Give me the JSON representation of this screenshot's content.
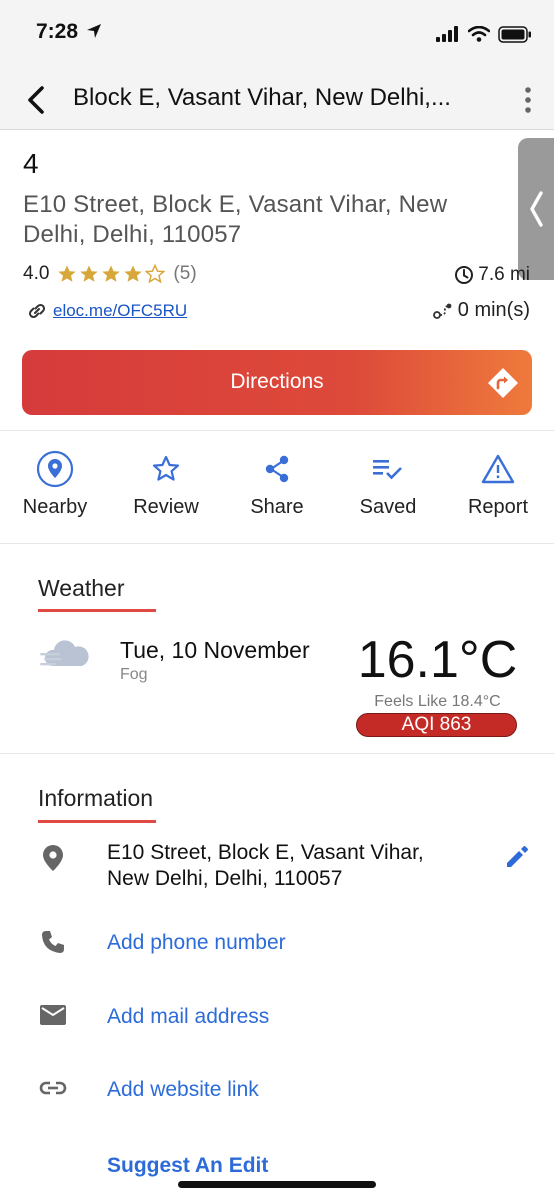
{
  "status_bar": {
    "time": "7:28"
  },
  "header": {
    "title": "Block E, Vasant Vihar, New Delhi,..."
  },
  "place": {
    "name": "4",
    "address": "E10 Street, Block E, Vasant Vihar, New Delhi, Delhi, 110057",
    "rating": "4.0",
    "rating_stars": 4,
    "rating_count": "(5)",
    "distance": "7.6 mi",
    "eloc": "eloc.me/OFC5RU",
    "duration": "0 min(s)"
  },
  "directions": {
    "label": "Directions"
  },
  "actions": [
    {
      "label": "Nearby",
      "icon": "location-pin-circle-icon"
    },
    {
      "label": "Review",
      "icon": "star-outline-icon"
    },
    {
      "label": "Share",
      "icon": "share-icon"
    },
    {
      "label": "Saved",
      "icon": "saved-list-icon"
    },
    {
      "label": "Report",
      "icon": "warning-triangle-icon"
    }
  ],
  "weather": {
    "title": "Weather",
    "date": "Tue, 10 November",
    "condition": "Fog",
    "temperature": "16.1°C",
    "feels_like": "Feels Like 18.4°C",
    "aqi": "AQI 863"
  },
  "information": {
    "title": "Information",
    "address": "E10 Street, Block E, Vasant Vihar, New Delhi, Delhi, 110057",
    "phone_link": "Add phone number",
    "mail_link": "Add mail address",
    "website_link": "Add website link",
    "suggest_edit": "Suggest An Edit"
  },
  "colors": {
    "accent_red": "#e04a43",
    "link_blue": "#2c6bd9",
    "icon_blue": "#3b6fd8",
    "star_gold": "#d8a73a",
    "aqi_red": "#c42b26"
  }
}
